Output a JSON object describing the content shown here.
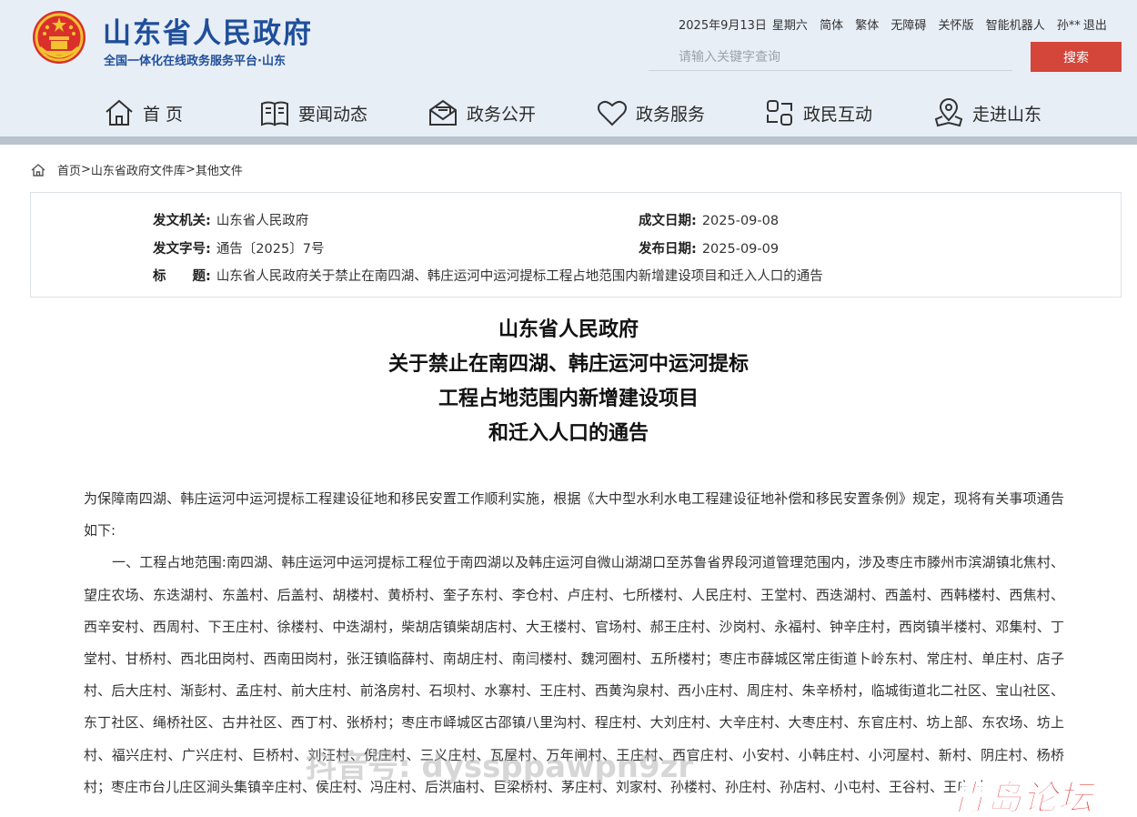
{
  "header": {
    "site_title": "山东省人民政府",
    "site_subtitle": "全国一体化在线政务服务平台·山东",
    "date": "2025年9月13日",
    "weekday": "星期六",
    "links": [
      "简体",
      "繁体",
      "无障碍",
      "关怀版",
      "智能机器人"
    ],
    "user": "孙**",
    "logout": "退出",
    "search_placeholder": "请输入关键字查询",
    "search_button": "搜索"
  },
  "nav": [
    {
      "label": "首 页",
      "icon": "home-icon"
    },
    {
      "label": "要闻动态",
      "icon": "book-icon"
    },
    {
      "label": "政务公开",
      "icon": "mail-icon"
    },
    {
      "label": "政务服务",
      "icon": "heart-icon"
    },
    {
      "label": "政民互动",
      "icon": "interaction-icon"
    },
    {
      "label": "走进山东",
      "icon": "location-icon"
    }
  ],
  "breadcrumb": {
    "home": "首页",
    "sep": ">",
    "level1": "山东省政府文件库",
    "level2": "其他文件"
  },
  "meta": {
    "issuer_label": "发文机关:",
    "issuer": "山东省人民政府",
    "doc_no_label": "发文字号:",
    "doc_no": "通告〔2025〕7号",
    "title_label": "标　　题:",
    "title": "山东省人民政府关于禁止在南四湖、韩庄运河中运河提标工程占地范围内新增建设项目和迁入人口的通告",
    "created_label": "成文日期:",
    "created": "2025-09-08",
    "published_label": "发布日期:",
    "published": "2025-09-09"
  },
  "doc_title": {
    "line1": "山东省人民政府",
    "line2": "关于禁止在南四湖、韩庄运河中运河提标",
    "line3": "工程占地范围内新增建设项目",
    "line4": "和迁入人口的通告"
  },
  "body": {
    "intro": "为保障南四湖、韩庄运河中运河提标工程建设征地和移民安置工作顺利实施，根据《大中型水利水电工程建设征地补偿和移民安置条例》规定，现将有关事项通告如下:",
    "para1": "一、工程占地范围:南四湖、韩庄运河中运河提标工程位于南四湖以及韩庄运河自微山湖湖口至苏鲁省界段河道管理范围内，涉及枣庄市滕州市滨湖镇北焦村、望庄农场、东迭湖村、东盖村、后盖村、胡楼村、黄桥村、奎子东村、李仓村、卢庄村、七所楼村、人民庄村、王堂村、西迭湖村、西盖村、西韩楼村、西焦村、西辛安村、西周村、下王庄村、徐楼村、中迭湖村，柴胡店镇柴胡店村、大王楼村、官场村、郝王庄村、沙岗村、永福村、钟辛庄村，西岗镇半楼村、邓集村、丁堂村、甘桥村、西北田岗村、西南田岗村，张汪镇临薛村、南胡庄村、南闫楼村、魏河圈村、五所楼村；枣庄市薛城区常庄街道卜岭东村、常庄村、单庄村、店子村、后大庄村、渐彭村、孟庄村、前大庄村、前洛房村、石坝村、水寨村、王庄村、西黄沟泉村、西小庄村、周庄村、朱辛桥村，临城街道北二社区、宝山社区、东丁社区、绳桥社区、古井社区、西丁村、张桥村；枣庄市峄城区古邵镇八里沟村、程庄村、大刘庄村、大辛庄村、大枣庄村、东官庄村、坊上部、东农场、坊上村、福兴庄村、广兴庄村、巨桥村、刘汪村、倪庄村、三义庄村、瓦屋村、万年闸村、王庄村、西官庄村、小安村、小韩庄村、小河屋村、新村、阴庄村、杨桥村；枣庄市台儿庄区涧头集镇辛庄村、侯庄村、冯庄村、后洪庙村、巨梁桥村、茅庄村、刘家村、孙楼村、孙庄村、孙店村、小屯村、王谷村、王庄村"
  },
  "watermarks": {
    "douyin": "抖音号: dyssppawpn9zr",
    "forum": "青岛论坛"
  }
}
